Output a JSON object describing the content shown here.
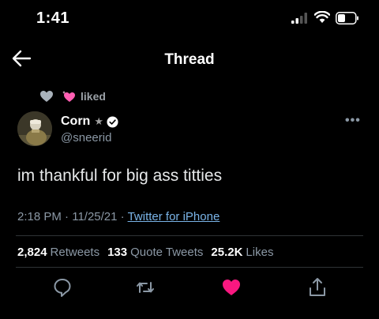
{
  "status_bar": {
    "time": "1:41"
  },
  "header": {
    "title": "Thread"
  },
  "social_context": {
    "text": "liked"
  },
  "author": {
    "name": "Corn",
    "badge_glyph": "★",
    "handle": "@sneerid"
  },
  "more_glyph": "•••",
  "tweet": {
    "text": "im thankful for big ass titties"
  },
  "meta": {
    "time": "2:18 PM",
    "separator": "·",
    "date": "11/25/21",
    "source": "Twitter for iPhone"
  },
  "stats": {
    "retweets_count": "2,824",
    "retweets_label": "Retweets",
    "quotes_count": "133",
    "quotes_label": "Quote Tweets",
    "likes_count": "25.2K",
    "likes_label": "Likes"
  },
  "actions": [
    "reply-icon",
    "retweet-icon",
    "like-icon",
    "share-icon"
  ],
  "colors": {
    "background": "#000000",
    "like_pink": "#f91880",
    "link": "#7ab4e8",
    "muted": "#8b98a5"
  }
}
